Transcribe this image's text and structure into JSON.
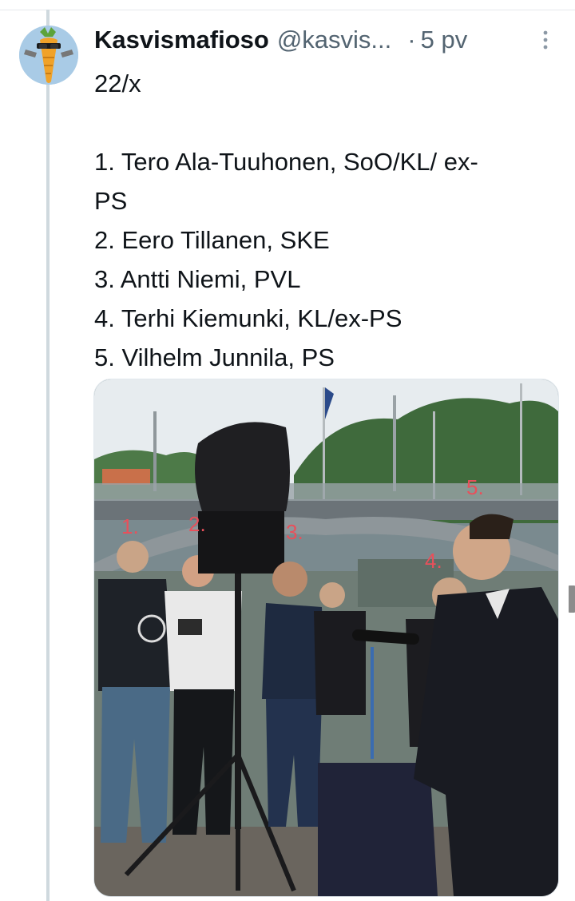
{
  "post": {
    "display_name": "Kasvismafioso",
    "handle": "@kasvis...",
    "separator": "·",
    "time": "5 pv",
    "text_lines": [
      "22/x",
      "",
      "1. Tero Ala-Tuuhonen, SoO/KL/ ex-PS",
      "2. Eero Tillanen, SKE",
      "3. Antti Niemi, PVL",
      "4. Terhi Kiemunki, KL/ex-PS",
      "5. Vilhelm Junnila, PS"
    ]
  },
  "photo": {
    "labels": [
      "1.",
      "2.",
      "3.",
      "4.",
      "5."
    ]
  },
  "icons": {
    "more": "more-vertical-icon",
    "avatar": "carrot-avatar"
  },
  "colors": {
    "accent_label": "#e8505b",
    "thread_line": "#cfd9de",
    "secondary_text": "#536471"
  }
}
